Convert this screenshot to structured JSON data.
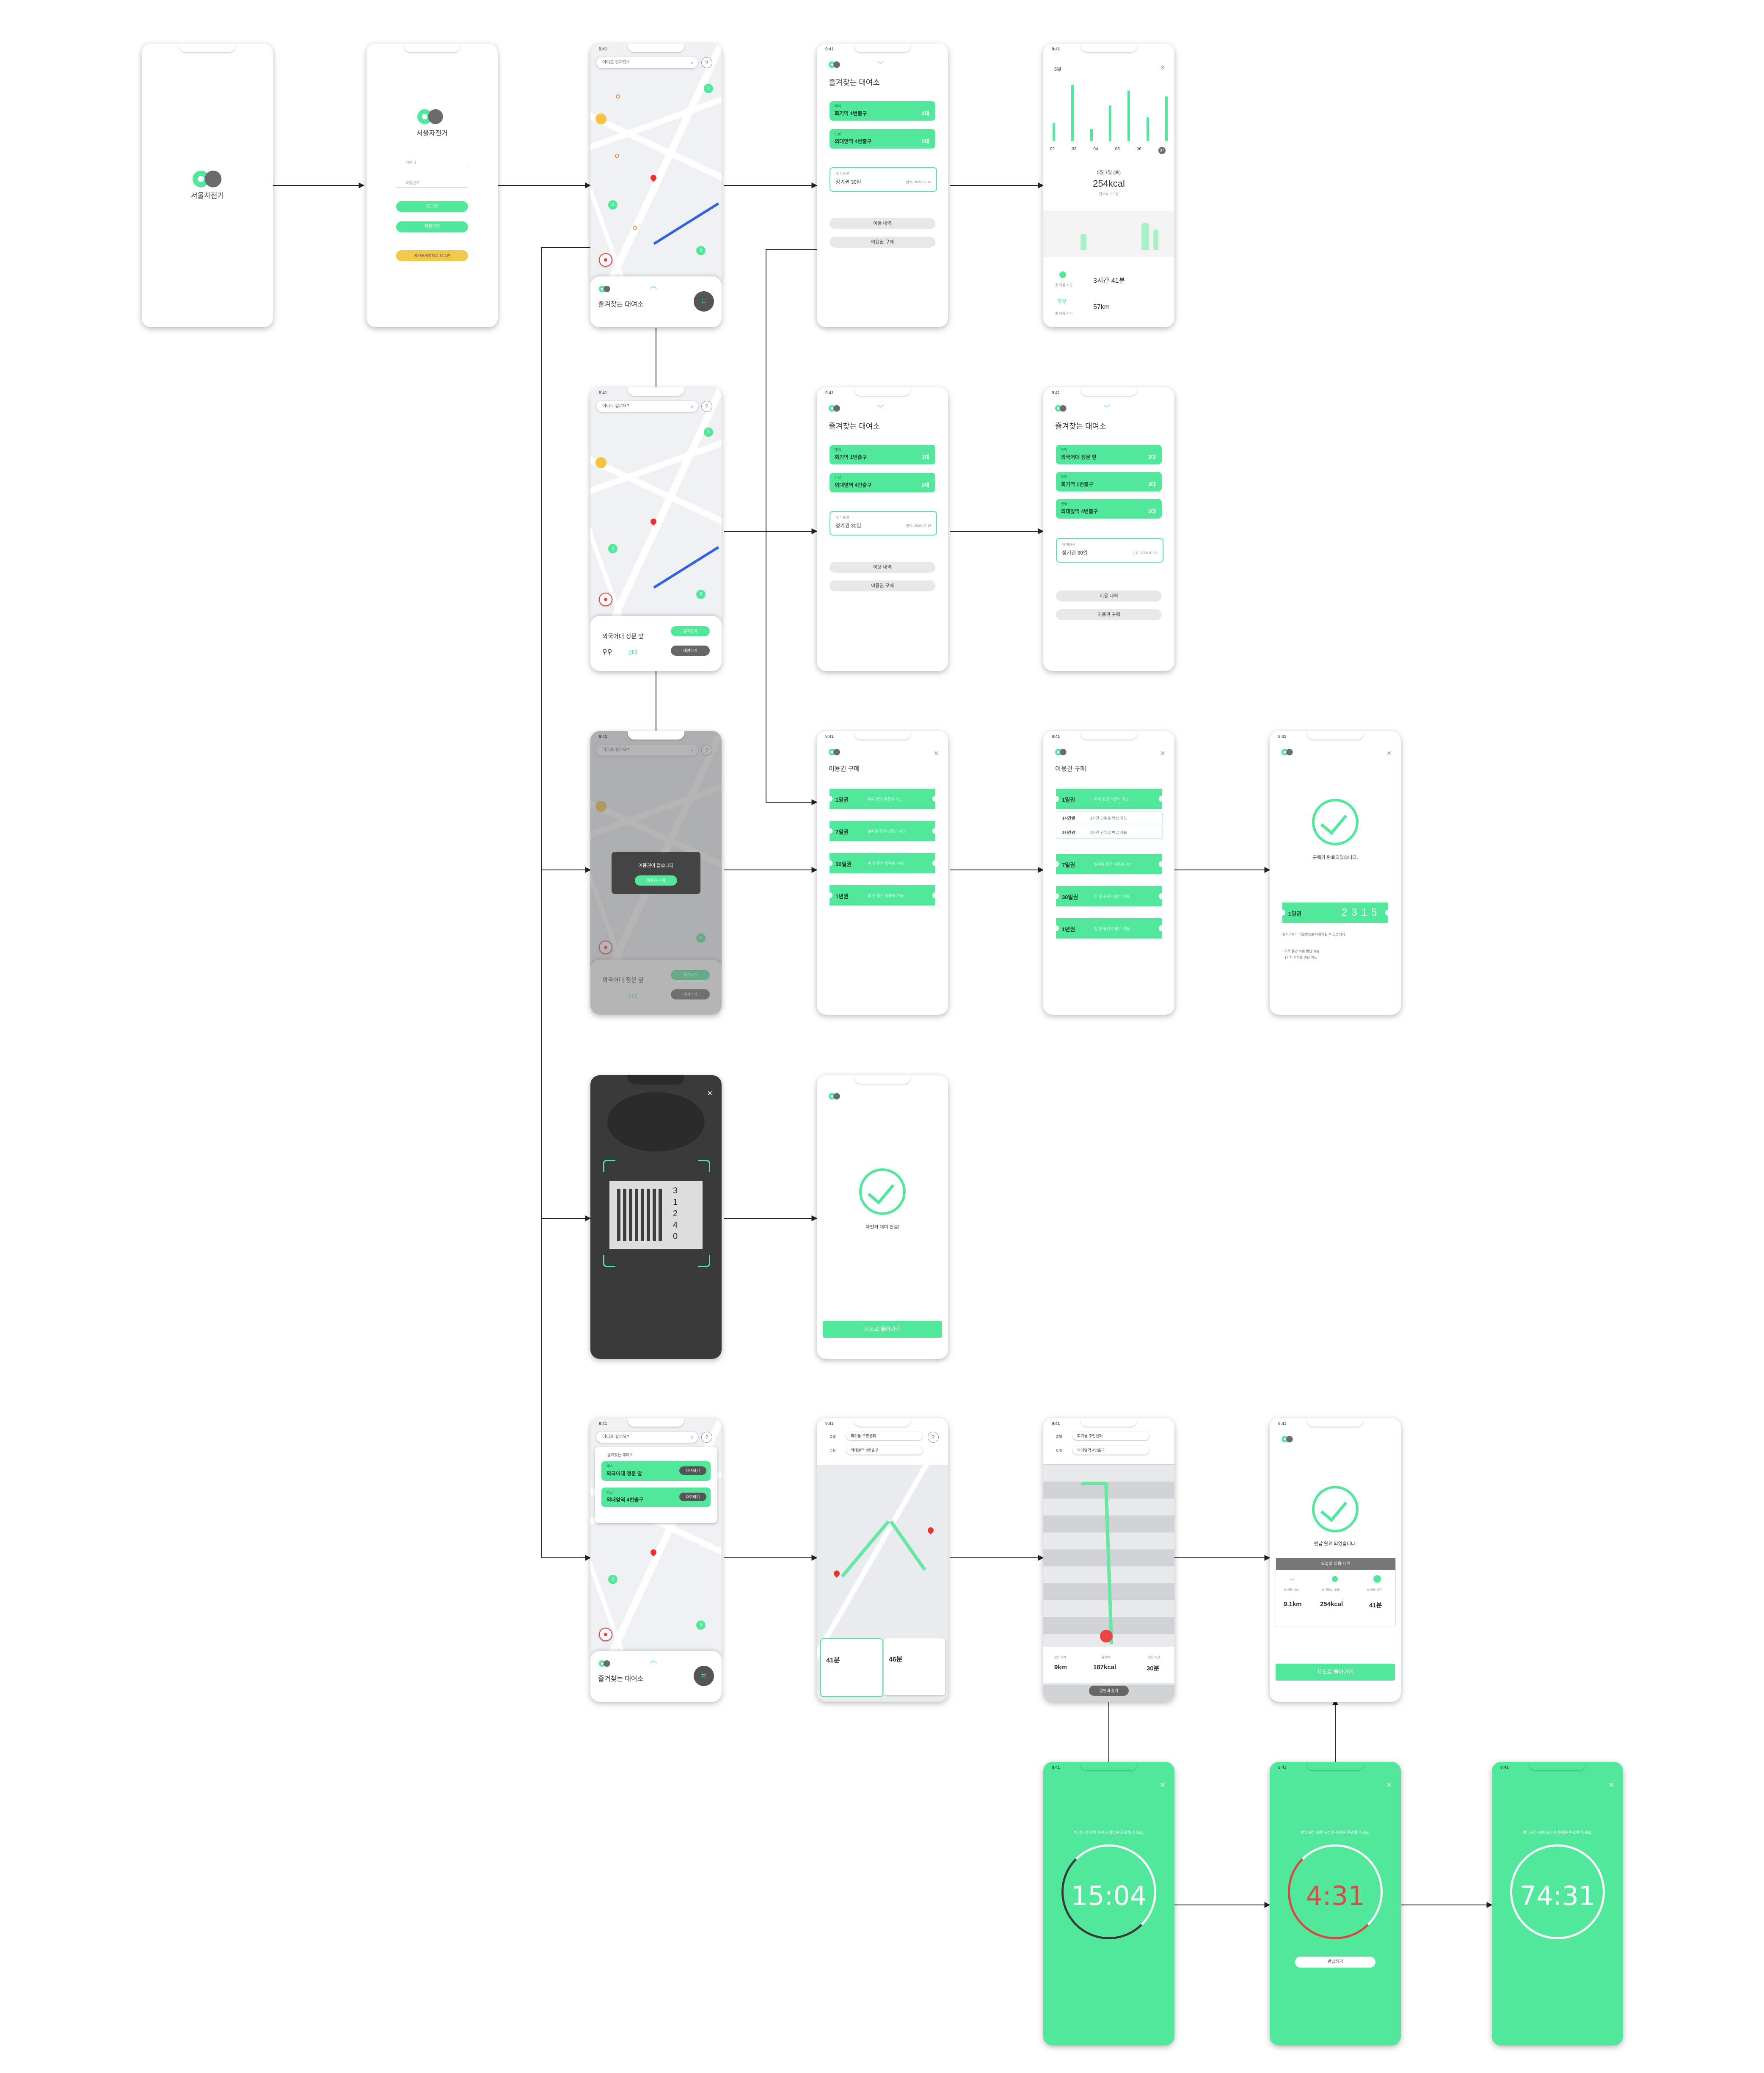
{
  "app": {
    "name": "서울자전거",
    "time": "9:41"
  },
  "login": {
    "id_placeholder": "아이디",
    "pw_placeholder": "비밀번호",
    "login_button": "로그인",
    "signup_button": "회원가입",
    "kakao_button": "카카오계정으로 로그인"
  },
  "map": {
    "search_placeholder": "어디로 갈까요?",
    "help": "?",
    "marker_counts": [
      "3",
      "2",
      "6",
      "5"
    ],
    "favorites_title": "즐겨찾는 대여소"
  },
  "favorites": {
    "title": "즐겨찾는 대여소",
    "stations_a": [
      {
        "sub": "대여",
        "name": "회기역 1번출구",
        "count": "3대"
      },
      {
        "sub": "반납",
        "name": "외대앞역 4번출구",
        "count": "5대"
      }
    ],
    "stations_b": [
      {
        "sub": "대여",
        "name": "외국어대 정문 앞",
        "count": "2대"
      },
      {
        "sub": "대여",
        "name": "회기역 1번출구",
        "count": "3대"
      },
      {
        "sub": "반납",
        "name": "외대앞역 4번출구",
        "count": "5대"
      }
    ],
    "pass_label": "내 이용권",
    "pass_name": "정기권 30일",
    "pass_date": "만료: 2020.07.13",
    "history_button": "이용 내역",
    "buy_button": "이용권 구매"
  },
  "station_popup": {
    "name": "외국어대 정문 앞",
    "count": "2대",
    "rent_button": "대여하기",
    "fav_button": "즐겨찾기"
  },
  "no_pass": {
    "message": "이용권이 없습니다",
    "button": "이용권 구매"
  },
  "stats": {
    "period": "5월",
    "days": [
      "02",
      "03",
      "04",
      "05",
      "06",
      "07"
    ],
    "date": "5월 7일 (토)",
    "kcal": "254kcal",
    "kcal_sub": "칼로리 소모량",
    "time_label": "총 이용 시간",
    "time_value": "3시간 41분",
    "dist_label": "총 이동 거리",
    "dist_value": "57km",
    "bars": [
      30,
      95,
      20,
      60,
      85,
      40,
      75
    ]
  },
  "purchase": {
    "title": "이용권 구매",
    "passes": [
      {
        "key": "1일권",
        "desc": "하루 동안 이용이 가능"
      },
      {
        "key": "7일권",
        "desc": "일주일 동안 이용이 가능"
      },
      {
        "key": "30일권",
        "desc": "한 달 동안 이용이 가능"
      },
      {
        "key": "1년권",
        "desc": "일 년 동안 이용이 가능"
      }
    ],
    "options": [
      {
        "key": "1시간권",
        "desc": "1시간 단위로 반납 가능"
      },
      {
        "key": "2시간권",
        "desc": "2시간 단위로 반납 가능"
      }
    ],
    "complete": "구매가 완료되었습니다.",
    "ticket_key": "1일권",
    "ticket_code": "2315",
    "note1": "위의 4자리 비밀번호로 이용하실 수 있습니다.",
    "note2": "· 하루 동안 이용 반납 가능",
    "note3": "· 1시간 단위로 반납 가능"
  },
  "qr": {
    "close": "×",
    "code": "31240"
  },
  "rent_done": {
    "message": "자전거 대여 완료!",
    "button": "지도로 돌아가기"
  },
  "nav": {
    "origin_label": "출발",
    "origin": "회기동 주민센터",
    "dest_label": "도착",
    "dest": "외대앞역 4번출구",
    "time": "41분",
    "time2": "46분",
    "dist": "9km",
    "kcal": "187kcal",
    "eta": "30분",
    "end_button": "길안내 끝기",
    "dist_label": "남은 거리",
    "kcal_label": "칼로리",
    "eta_label": "남은 시간"
  },
  "return_done": {
    "message": "반납 완료 되었습니다.",
    "summary_title": "오늘의 이용 내역",
    "dist_label": "총 이동 거리",
    "dist": "9.1km",
    "kcal_label": "총 칼로리 소모",
    "kcal": "254kcal",
    "time_label": "총 이용 시간",
    "time": "41분",
    "button": "지도로 돌아가기"
  },
  "timers": [
    {
      "value": "15:04",
      "msg": "반납시간 내에 자전거 정상을 완료해 주세요.",
      "color": "#ffffff"
    },
    {
      "value": "4:31",
      "msg": "반납시간 내에 자전거 정상을 완료해 주세요.",
      "color": "#d94a4a",
      "button": "반납하기"
    },
    {
      "value": "74:31",
      "msg": "반납시간 내에 자전거 정상을 완료해 주세요.",
      "color": "#ffffff"
    }
  ],
  "colors": {
    "accent": "#51e89b",
    "dark": "#555555",
    "kakao": "#f2c84b",
    "alert": "#d94a4a"
  }
}
